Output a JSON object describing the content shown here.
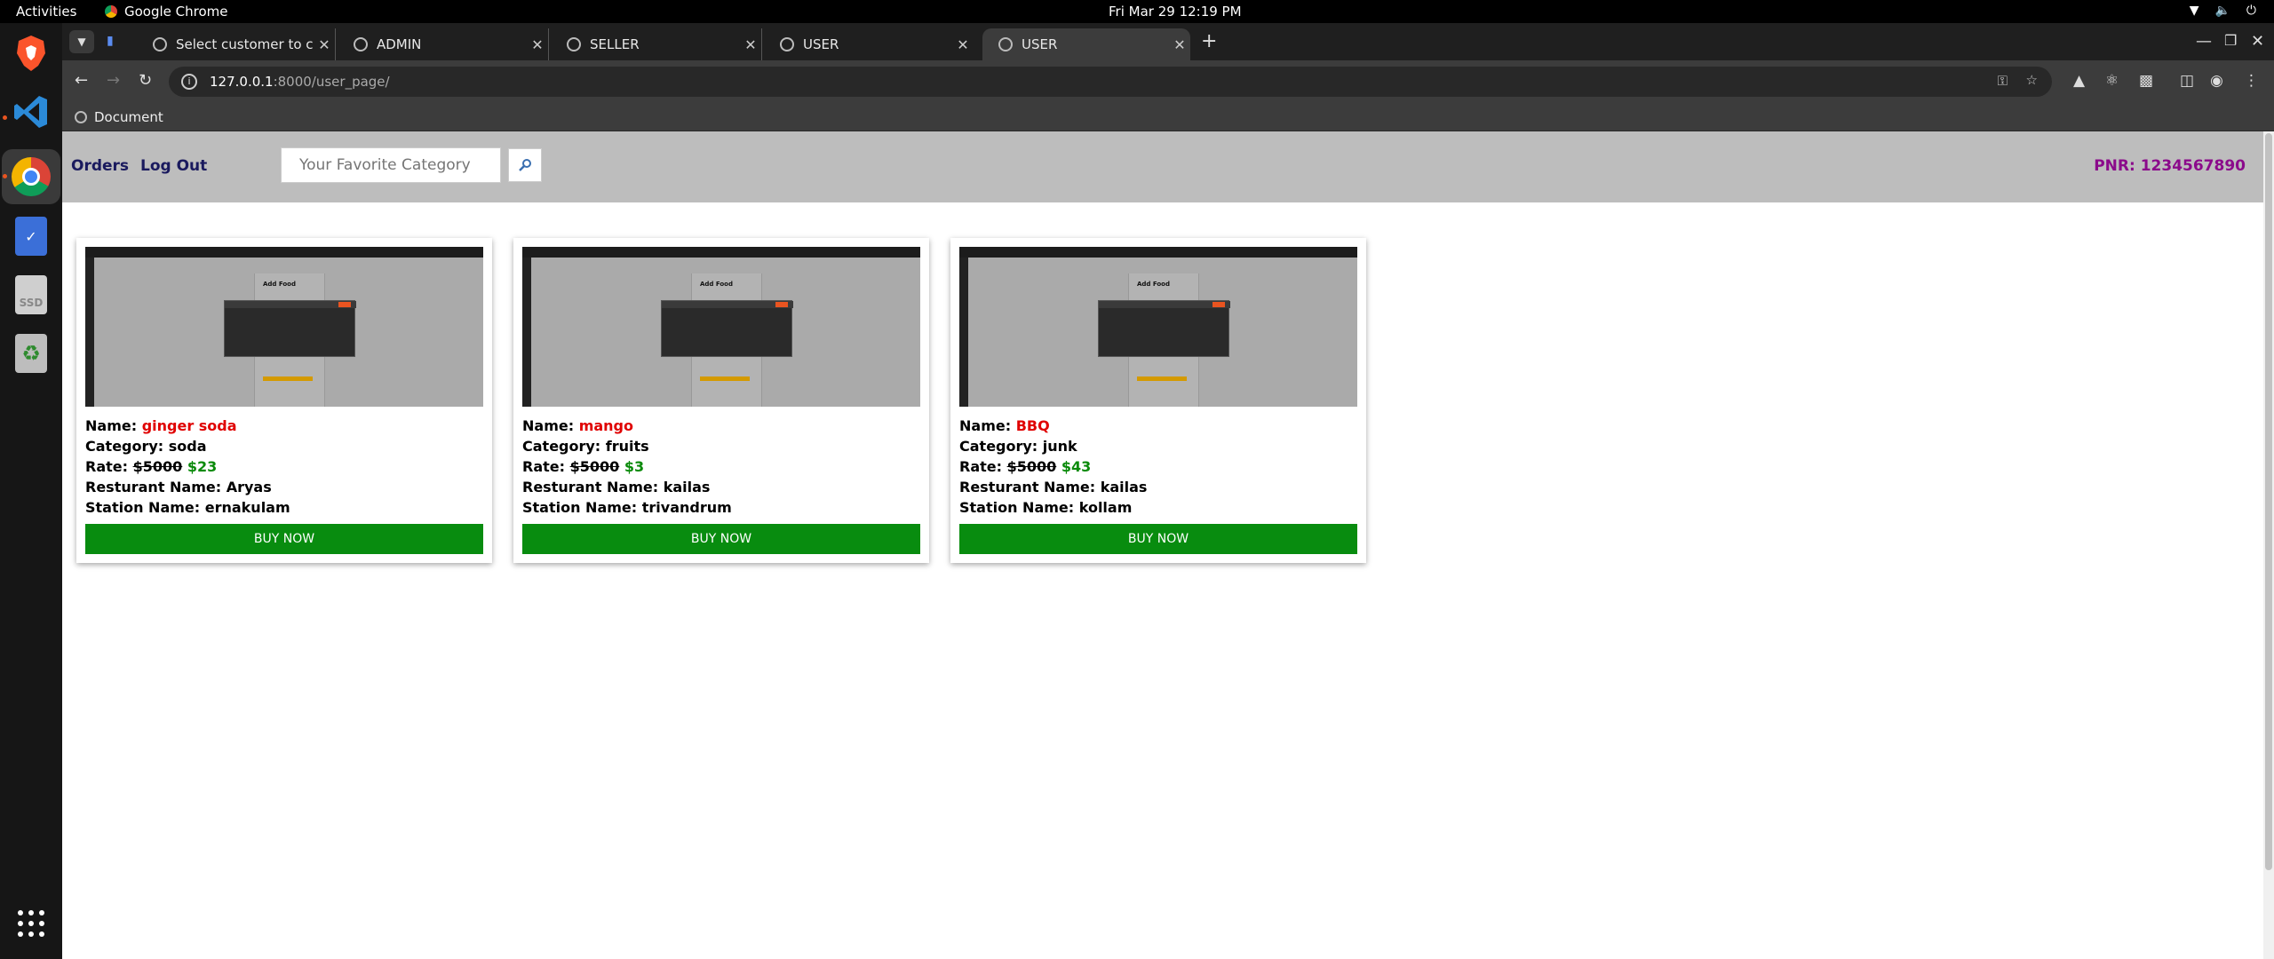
{
  "os": {
    "activities": "Activities",
    "app_name": "Google Chrome",
    "clock": "Fri Mar 29  12:19 PM"
  },
  "browser": {
    "tabs": [
      {
        "title": "Select customer to chang"
      },
      {
        "title": "ADMIN"
      },
      {
        "title": "SELLER"
      },
      {
        "title": "USER"
      },
      {
        "title": "USER"
      }
    ],
    "url_host": "127.0.0.1",
    "url_path": ":8000/user_page/",
    "bookmark": "Document"
  },
  "page": {
    "nav": {
      "orders": "Orders",
      "logout": "Log Out"
    },
    "search": {
      "placeholder": "Your Favorite Category"
    },
    "pnr": "PNR: 1234567890",
    "labels": {
      "name": "Name: ",
      "category": "Category: ",
      "rate": "Rate: ",
      "restaurant": "Resturant Name: ",
      "station": "Station Name: ",
      "buy": "BUY NOW"
    },
    "thumbnail_title": "Add Food",
    "products": [
      {
        "name": "ginger soda",
        "category": "soda",
        "old_price": "$5000",
        "price": "$23",
        "restaurant": "Aryas",
        "station": "ernakulam"
      },
      {
        "name": "mango",
        "category": "fruits",
        "old_price": "$5000",
        "price": "$3",
        "restaurant": "kailas",
        "station": "trivandrum"
      },
      {
        "name": "BBQ",
        "category": "junk",
        "old_price": "$5000",
        "price": "$43",
        "restaurant": "kailas",
        "station": "kollam"
      }
    ]
  },
  "colors": {
    "accent_red": "#e00000",
    "price_green": "#0a8a0a",
    "buy_button": "#088c0f",
    "pnr": "#8b0a8b",
    "navbar": "#bdbdbd"
  }
}
